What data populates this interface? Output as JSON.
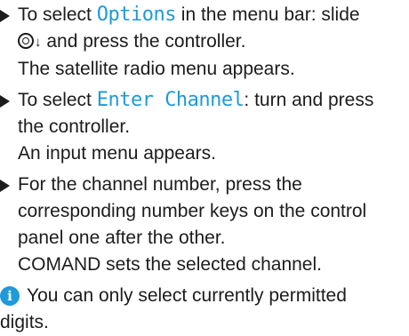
{
  "steps": [
    {
      "lines": [
        {
          "pre": "To select ",
          "hl": "Options",
          "post": " in the menu bar: slide"
        },
        {
          "post": " and press the controller."
        },
        {
          "text": "The satellite radio menu appears."
        }
      ]
    },
    {
      "lines": [
        {
          "pre": "To select ",
          "hl": "Enter Channel",
          "post": ": turn and press"
        },
        {
          "text": "the controller."
        },
        {
          "text": "An input menu appears."
        }
      ]
    },
    {
      "lines": [
        {
          "text": "For the channel number, press the"
        },
        {
          "text": "corresponding number keys on the control"
        },
        {
          "text": "panel one after the other."
        },
        {
          "text": "COMAND sets the selected channel."
        }
      ]
    }
  ],
  "info": {
    "icon": "i",
    "line1": "You can only select currently permitted",
    "line2": "digits."
  },
  "icons": {
    "controller": "controller-icon",
    "arrow": "↓"
  },
  "colors": {
    "highlight": "#1f9ad8",
    "text": "#1c1c1c"
  }
}
